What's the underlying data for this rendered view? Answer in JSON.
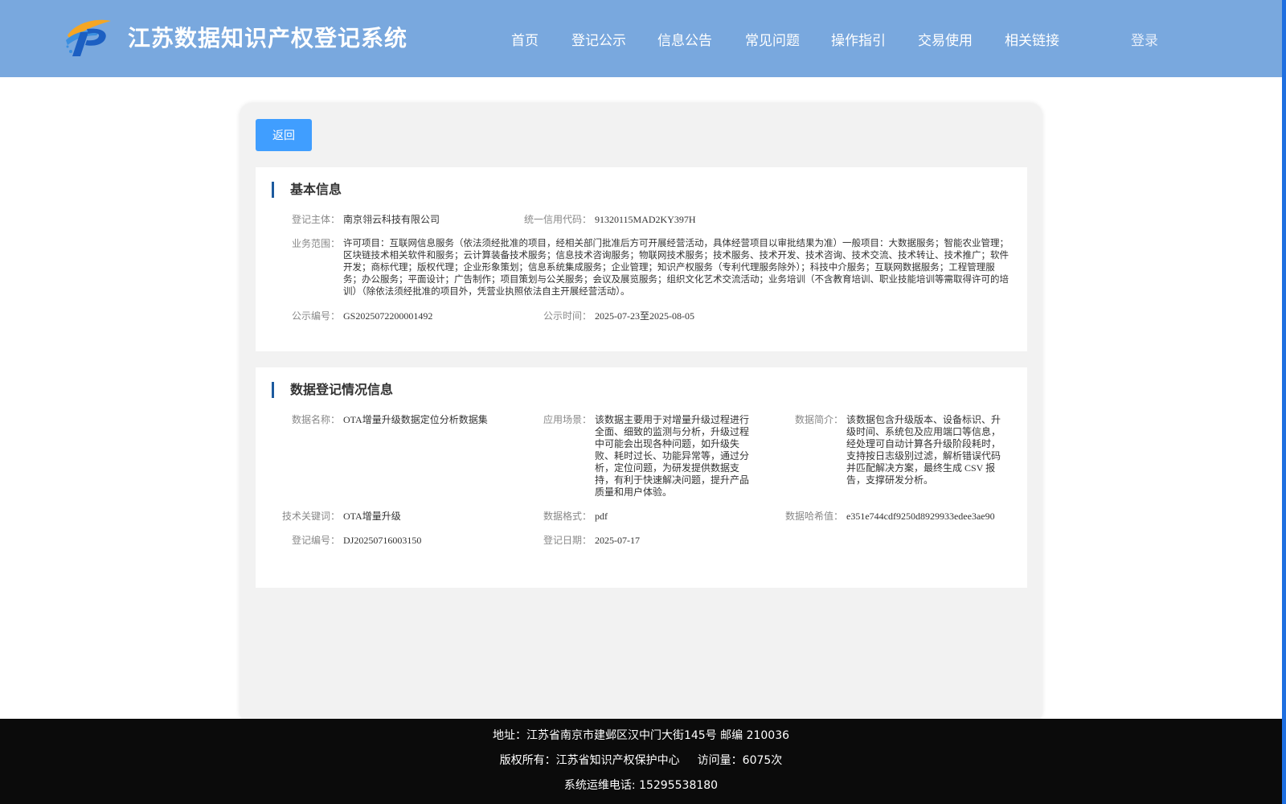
{
  "header": {
    "title": "江苏数据知识产权登记系统",
    "nav": [
      "首页",
      "登记公示",
      "信息公告",
      "常见问题",
      "操作指引",
      "交易使用",
      "相关链接"
    ],
    "login": "登录"
  },
  "back_label": "返回",
  "basic_info": {
    "title": "基本信息",
    "subject_label": "登记主体：",
    "subject": "南京翎云科技有限公司",
    "credit_label": "统一信用代码：",
    "credit": "91320115MAD2KY397H",
    "scope_label": "业务范围：",
    "scope": "许可项目：互联网信息服务（依法须经批准的项目，经相关部门批准后方可开展经营活动，具体经营项目以审批结果为准）一般项目：大数据服务；智能农业管理；区块链技术相关软件和服务；云计算装备技术服务；信息技术咨询服务；物联网技术服务；技术服务、技术开发、技术咨询、技术交流、技术转让、技术推广；软件开发；商标代理；版权代理；企业形象策划；信息系统集成服务；企业管理；知识产权服务（专利代理服务除外）；科技中介服务；互联网数据服务；工程管理服务；办公服务；平面设计；广告制作；项目策划与公关服务；会议及展览服务；组织文化艺术交流活动；业务培训（不含教育培训、职业技能培训等需取得许可的培训）（除依法须经批准的项目外，凭营业执照依法自主开展经营活动）。",
    "pub_no_label": "公示编号：",
    "pub_no": "GS2025072200001492",
    "pub_time_label": "公示时间：",
    "pub_time": "2025-07-23至2025-08-05"
  },
  "data_info": {
    "title": "数据登记情况信息",
    "name_label": "数据名称：",
    "name": "OTA增量升级数据定位分析数据集",
    "scene_label": "应用场景：",
    "scene": "该数据主要用于对增量升级过程进行全面、细致的监测与分析，升级过程中可能会出现各种问题，如升级失败、耗时过长、功能异常等，通过分析，定位问题，为研发提供数据支持，有利于快速解决问题，提升产品质量和用户体验。",
    "intro_label": "数据简介：",
    "intro": "该数据包含升级版本、设备标识、升级时间、系统包及应用端口等信息，经处理可自动计算各升级阶段耗时，支持按日志级别过滤，解析错误代码并匹配解决方案，最终生成 CSV 报告，支撑研发分析。",
    "keyword_label": "技术关键词：",
    "keyword": "OTA增量升级",
    "format_label": "数据格式：",
    "format": "pdf",
    "hash_label": "数据哈希值：",
    "hash": "e351e744cdf9250d8929933edee3ae90",
    "reg_no_label": "登记编号：",
    "reg_no": "DJ20250716003150",
    "reg_date_label": "登记日期：",
    "reg_date": "2025-07-17"
  },
  "footer": {
    "address": "地址：江苏省南京市建邺区汉中门大街145号 邮编 210036",
    "copyright": "版权所有：江苏省知识产权保护中心",
    "visits": "访问量：6075次",
    "phone": "系统运维电话: 15295538180"
  }
}
